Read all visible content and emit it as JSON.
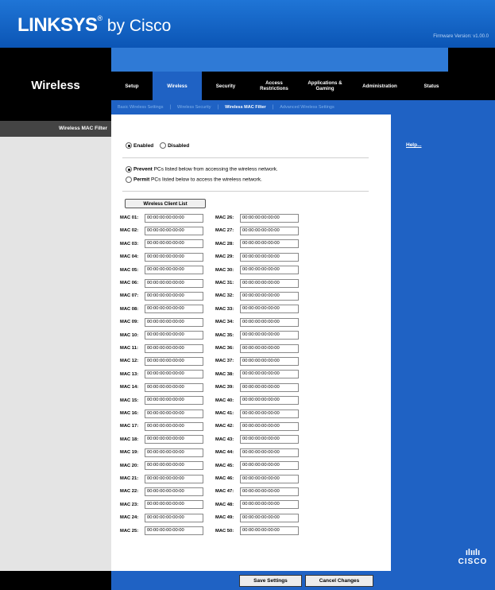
{
  "header": {
    "brand": "LINKSYS",
    "brand_suffix": "by Cisco",
    "firmware": "Firmware Version: v1.00.0"
  },
  "section_title": "Wireless",
  "tabs": [
    {
      "label": "Setup"
    },
    {
      "label": "Wireless",
      "active": true
    },
    {
      "label": "Security"
    },
    {
      "label": "Access\nRestrictions"
    },
    {
      "label": "Applications &\nGaming"
    },
    {
      "label": "Administration"
    },
    {
      "label": "Status"
    }
  ],
  "subtabs": [
    {
      "label": "Basic Wireless Settings"
    },
    {
      "label": "Wireless Security"
    },
    {
      "label": "Wireless MAC Filter",
      "active": true
    },
    {
      "label": "Advanced Wireless Settings"
    }
  ],
  "left_panel": {
    "label": "Wireless MAC Filter"
  },
  "filter": {
    "enabled_label": "Enabled",
    "disabled_label": "Disabled",
    "state": "Enabled",
    "prevent_bold": "Prevent",
    "prevent_text": "PCs listed below from accessing the wireless network.",
    "permit_bold": "Permit",
    "permit_text": "PCs listed below to access the wireless network.",
    "policy": "Prevent"
  },
  "client_list_button": "Wireless Client List",
  "mac_list": {
    "left": [
      {
        "label": "MAC 01:",
        "value": "00:00:00:00:00:00"
      },
      {
        "label": "MAC 02:",
        "value": "00:00:00:00:00:00"
      },
      {
        "label": "MAC 03:",
        "value": "00:00:00:00:00:00"
      },
      {
        "label": "MAC 04:",
        "value": "00:00:00:00:00:00"
      },
      {
        "label": "MAC 05:",
        "value": "00:00:00:00:00:00"
      },
      {
        "label": "MAC 06:",
        "value": "00:00:00:00:00:00"
      },
      {
        "label": "MAC 07:",
        "value": "00:00:00:00:00:00"
      },
      {
        "label": "MAC 08:",
        "value": "00:00:00:00:00:00"
      },
      {
        "label": "MAC 09:",
        "value": "00:00:00:00:00:00"
      },
      {
        "label": "MAC 10:",
        "value": "00:00:00:00:00:00"
      },
      {
        "label": "MAC 11:",
        "value": "00:00:00:00:00:00"
      },
      {
        "label": "MAC 12:",
        "value": "00:00:00:00:00:00"
      },
      {
        "label": "MAC 13:",
        "value": "00:00:00:00:00:00"
      },
      {
        "label": "MAC 14:",
        "value": "00:00:00:00:00:00"
      },
      {
        "label": "MAC 15:",
        "value": "00:00:00:00:00:00"
      },
      {
        "label": "MAC 16:",
        "value": "00:00:00:00:00:00"
      },
      {
        "label": "MAC 17:",
        "value": "00:00:00:00:00:00"
      },
      {
        "label": "MAC 18:",
        "value": "00:00:00:00:00:00"
      },
      {
        "label": "MAC 19:",
        "value": "00:00:00:00:00:00"
      },
      {
        "label": "MAC 20:",
        "value": "00:00:00:00:00:00"
      },
      {
        "label": "MAC 21:",
        "value": "00:00:00:00:00:00"
      },
      {
        "label": "MAC 22:",
        "value": "00:00:00:00:00:00"
      },
      {
        "label": "MAC 23:",
        "value": "00:00:00:00:00:00"
      },
      {
        "label": "MAC 24:",
        "value": "00:00:00:00:00:00"
      },
      {
        "label": "MAC 25:",
        "value": "00:00:00:00:00:00"
      }
    ],
    "right": [
      {
        "label": "MAC 26:",
        "value": "00:00:00:00:00:00"
      },
      {
        "label": "MAC 27:",
        "value": "00:00:00:00:00:00"
      },
      {
        "label": "MAC 28:",
        "value": "00:00:00:00:00:00"
      },
      {
        "label": "MAC 29:",
        "value": "00:00:00:00:00:00"
      },
      {
        "label": "MAC 30:",
        "value": "00:00:00:00:00:00"
      },
      {
        "label": "MAC 31:",
        "value": "00:00:00:00:00:00"
      },
      {
        "label": "MAC 32:",
        "value": "00:00:00:00:00:00"
      },
      {
        "label": "MAC 33:",
        "value": "00:00:00:00:00:00"
      },
      {
        "label": "MAC 34:",
        "value": "00:00:00:00:00:00"
      },
      {
        "label": "MAC 35:",
        "value": "00:00:00:00:00:00"
      },
      {
        "label": "MAC 36:",
        "value": "00:00:00:00:00:00"
      },
      {
        "label": "MAC 37:",
        "value": "00:00:00:00:00:00"
      },
      {
        "label": "MAC 38:",
        "value": "00:00:00:00:00:00"
      },
      {
        "label": "MAC 39:",
        "value": "00:00:00:00:00:00"
      },
      {
        "label": "MAC 40:",
        "value": "00:00:00:00:00:00"
      },
      {
        "label": "MAC 41:",
        "value": "00:00:00:00:00:00"
      },
      {
        "label": "MAC 42:",
        "value": "00:00:00:00:00:00"
      },
      {
        "label": "MAC 43:",
        "value": "00:00:00:00:00:00"
      },
      {
        "label": "MAC 44:",
        "value": "00:00:00:00:00:00"
      },
      {
        "label": "MAC 45:",
        "value": "00:00:00:00:00:00"
      },
      {
        "label": "MAC 46:",
        "value": "00:00:00:00:00:00"
      },
      {
        "label": "MAC 47:",
        "value": "00:00:00:00:00:00"
      },
      {
        "label": "MAC 48:",
        "value": "00:00:00:00:00:00"
      },
      {
        "label": "MAC 49:",
        "value": "00:00:00:00:00:00"
      },
      {
        "label": "MAC 50:",
        "value": "00:00:00:00:00:00"
      }
    ]
  },
  "help": {
    "label": "Help..."
  },
  "actions": {
    "save": "Save Settings",
    "cancel": "Cancel Changes"
  },
  "footer_logo": {
    "text": "CISCO",
    "bars": "ılıılı"
  },
  "colors": {
    "brand_blue": "#1f62c4",
    "header_blue": "#1f75d6",
    "black": "#000000",
    "panel_grey": "#e4e4e4"
  }
}
